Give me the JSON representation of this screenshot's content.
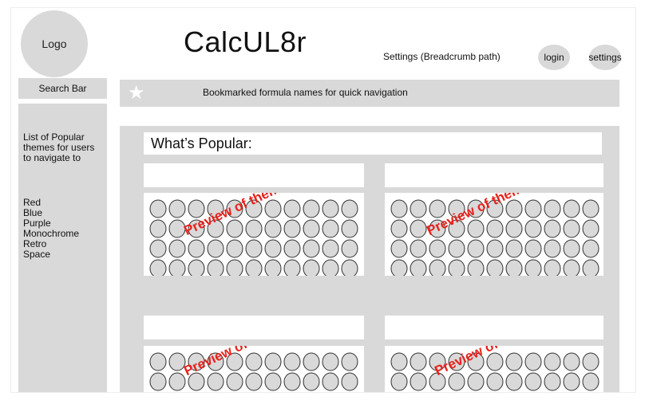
{
  "header": {
    "logo": "Logo",
    "title": "CalcUL8r",
    "breadcrumb": "Settings (Breadcrumb path)",
    "login": "login",
    "settings": "settings"
  },
  "search": {
    "label": "Search Bar"
  },
  "bookmarks": {
    "text": "Bookmarked formula names for quick navigation",
    "icon": "star-icon"
  },
  "sidebar": {
    "intro": "List of Popular themes for users to navigate to",
    "themes": [
      "Red",
      "Blue",
      "Purple",
      "Monochrome",
      "Retro",
      "Space"
    ]
  },
  "main": {
    "title": "What’s Popular:",
    "cards": [
      {
        "overlay": "Preview of theme"
      },
      {
        "overlay": "Preview of theme"
      },
      {
        "overlay": "Preview of theme"
      },
      {
        "overlay": "Preview of theme"
      }
    ]
  },
  "colors": {
    "placeholder": "#d9d9d9",
    "overlay_text": "#e8221c"
  }
}
